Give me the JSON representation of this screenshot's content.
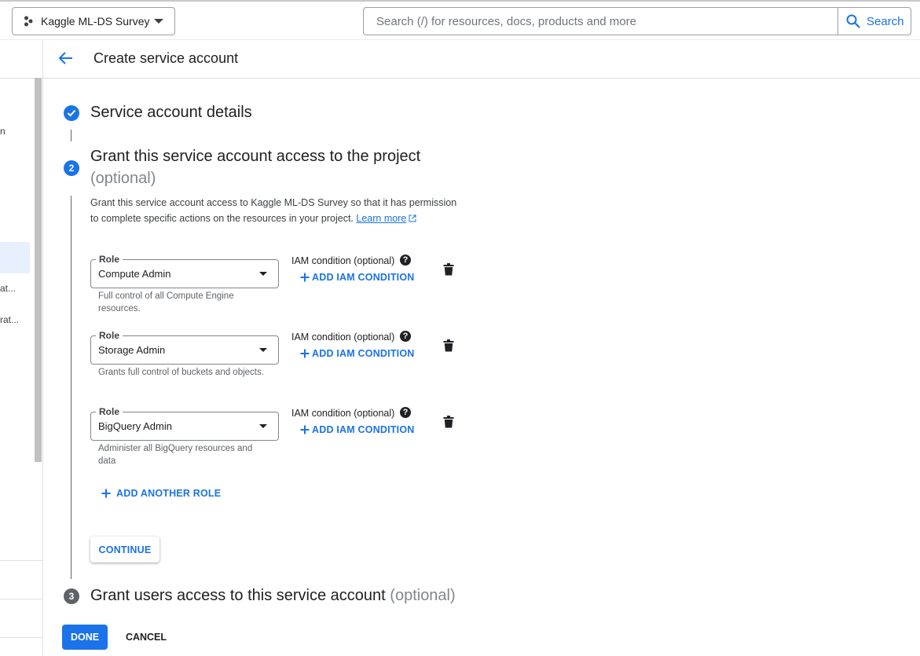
{
  "topbar": {
    "project_name": "Kaggle ML-DS Survey",
    "search_placeholder": "Search (/) for resources, docs, products and more",
    "search_button_label": "Search"
  },
  "left_rail": {
    "items": [
      {
        "label": "n"
      },
      {
        "label": "at..."
      },
      {
        "label": "rat..."
      }
    ]
  },
  "header": {
    "title": "Create service account"
  },
  "steps": {
    "step1": {
      "title": "Service account details"
    },
    "step2": {
      "number": "2",
      "title": "Grant this service account access to the project",
      "optional": "(optional)",
      "description": "Grant this service account access to Kaggle ML-DS Survey so that it has permission to complete specific actions on the resources in your project.",
      "learn_more": "Learn more"
    },
    "step3": {
      "number": "3",
      "title": "Grant users access to this service account",
      "optional": "(optional)"
    }
  },
  "roles": [
    {
      "legend": "Role",
      "value": "Compute Admin",
      "hint": "Full control of all Compute Engine resources.",
      "iam_label": "IAM condition (optional)",
      "add_iam": "ADD IAM CONDITION"
    },
    {
      "legend": "Role",
      "value": "Storage Admin",
      "hint": "Grants full control of buckets and objects.",
      "iam_label": "IAM condition (optional)",
      "add_iam": "ADD IAM CONDITION"
    },
    {
      "legend": "Role",
      "value": "BigQuery Admin",
      "hint": "Administer all BigQuery resources and data",
      "iam_label": "IAM condition (optional)",
      "add_iam": "ADD IAM CONDITION"
    }
  ],
  "actions": {
    "add_another_role": "ADD ANOTHER ROLE",
    "continue": "CONTINUE",
    "done": "DONE",
    "cancel": "CANCEL"
  },
  "colors": {
    "accent": "#1a73e8",
    "text": "#202124",
    "muted": "#5f6368"
  }
}
